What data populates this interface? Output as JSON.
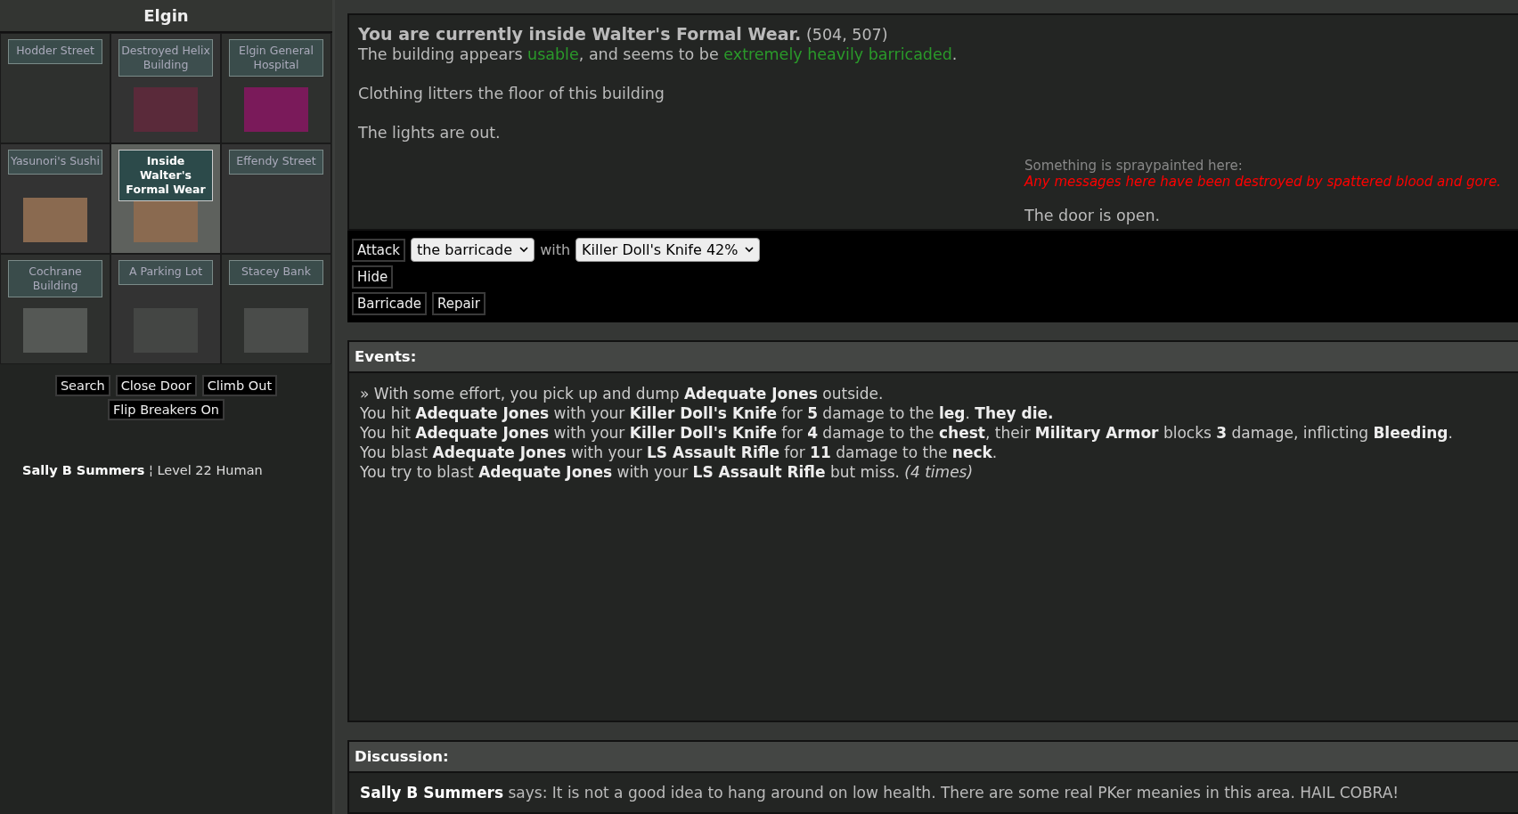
{
  "sidebar": {
    "title": "Elgin",
    "map_tiles": [
      {
        "label": "Hodder Street",
        "kind": "street",
        "selected": false
      },
      {
        "label": "Destroyed Helix Building",
        "kind": "ruin",
        "selected": false
      },
      {
        "label": "Elgin General Hospital",
        "kind": "hospital",
        "selected": false
      },
      {
        "label": "Yasunori's Sushi",
        "kind": "shop",
        "selected": false
      },
      {
        "label": "Inside Walter's Formal Wear",
        "kind": "shop",
        "selected": true
      },
      {
        "label": "Effendy Street",
        "kind": "street",
        "selected": false
      },
      {
        "label": "Cochrane Building",
        "kind": "office",
        "selected": false
      },
      {
        "label": "A Parking Lot",
        "kind": "lot",
        "selected": false
      },
      {
        "label": "Stacey Bank",
        "kind": "bank",
        "selected": false
      }
    ],
    "buttons": [
      [
        "Search",
        "Close Door",
        "Climb Out"
      ],
      [
        "Flip Breakers On"
      ]
    ],
    "character": {
      "name": "Sally B Summers",
      "separator": "¦",
      "description": "Level 22 Human"
    }
  },
  "location": {
    "heading": "You are currently inside Walter's Formal Wear.",
    "coords": "(504, 507)",
    "status": [
      {
        "text": "The building appears ",
        "highlight": false
      },
      {
        "text": "usable",
        "highlight": true
      },
      {
        "text": ", and seems to be ",
        "highlight": false
      },
      {
        "text": "extremely heavily barricaded",
        "highlight": true
      },
      {
        "text": ".",
        "highlight": false
      }
    ],
    "descriptions": [
      "Clothing litters the floor of this building",
      "The lights are out."
    ],
    "spraypaint": {
      "label": "Something is spraypainted here:",
      "message": "Any messages here have been destroyed by spattered blood and gore."
    },
    "door": "The door is open."
  },
  "actions": [
    [
      {
        "kind": "button",
        "text": "Attack"
      },
      {
        "kind": "select",
        "text": "the barricade"
      },
      {
        "kind": "text",
        "text": "with"
      },
      {
        "kind": "select",
        "text": "Killer Doll's Knife 42%"
      }
    ],
    [
      {
        "kind": "button",
        "text": "Hide"
      }
    ],
    [
      {
        "kind": "button",
        "text": "Barricade"
      },
      {
        "kind": "button",
        "text": "Repair"
      }
    ]
  ],
  "events": {
    "title": "Events:",
    "entries": [
      "» With some effort, you pick up and dump **Adequate Jones** outside.",
      "You hit **Adequate Jones** with your **Killer Doll's Knife** for **5** damage to the **leg**. **They die.**",
      "You hit **Adequate Jones** with your **Killer Doll's Knife** for **4** damage to the **chest**, their **Military Armor** blocks **3** damage, inflicting **Bleeding**.",
      "You blast **Adequate Jones** with your **LS Assault Rifle** for **11** damage to the **neck**.",
      "You try to blast **Adequate Jones** with your **LS Assault Rifle** but miss. *(4 times)*"
    ]
  },
  "discussion": {
    "title": "Discussion:",
    "messages": [
      {
        "speaker": "Sally B Summers",
        "text": "says: It is not a good idea to hang around on low health. There are some real PKer meanies in this area. HAIL COBRA!"
      }
    ]
  }
}
